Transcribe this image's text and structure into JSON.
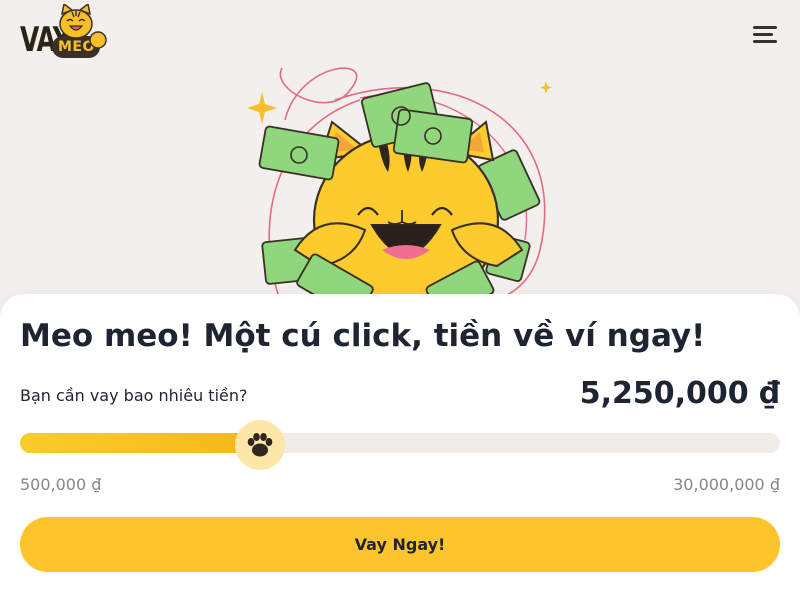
{
  "header": {
    "logo_primary": "VAY",
    "logo_secondary": "MEO",
    "logo_coin_symbol": "đ",
    "menu_icon": "hamburger-menu-icon"
  },
  "hero": {
    "illustration": "happy-cat-with-money-illustration"
  },
  "main": {
    "headline": "Meo meo! Một cú click, tiền về ví ngay!",
    "question": "Bạn cần vay bao nhiêu tiền?",
    "amount_display": "5,250,000 ₫",
    "slider": {
      "min_label": "500,000 ₫",
      "max_label": "30,000,000 ₫",
      "min_value": 500000,
      "max_value": 30000000,
      "value": 5250000,
      "thumb_icon": "paw-icon"
    },
    "cta_label": "Vay Ngay!"
  },
  "colors": {
    "accent": "#fdc42c",
    "accent_dark": "#f5b61a",
    "thumb_bg": "#fce7a8",
    "track": "#f1ece8",
    "text": "#1f2433",
    "muted": "#8a8680",
    "background": "#f2efec",
    "money_green": "#8fd67d"
  }
}
